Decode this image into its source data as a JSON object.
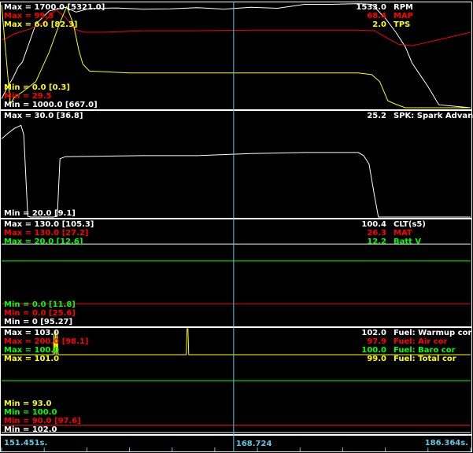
{
  "chart_data": [
    {
      "type": "line",
      "panel": "rpm-map-tps",
      "left_labels_top": [
        {
          "text": "Max = 1700.0 [5321.0]",
          "color": "#ffffff"
        },
        {
          "text": "Max = 99.5",
          "color": "#ff0000"
        },
        {
          "text": "Max = 6.0 [82.3]",
          "color": "#ffff00"
        }
      ],
      "left_labels_bottom": [
        {
          "text": "Min = 0.0 [0.3]",
          "color": "#ffff00"
        },
        {
          "text": "Min = 29.5",
          "color": "#ff0000"
        },
        {
          "text": "Min = 1000.0 [667.0]",
          "color": "#ffffff"
        }
      ],
      "right_labels": [
        {
          "value": "1533.0",
          "name": "RPM",
          "color": "#ffffff"
        },
        {
          "value": "68.4",
          "name": "MAP",
          "color": "#ff0000"
        },
        {
          "value": "2.0",
          "name": "TPS",
          "color": "#ffff00"
        }
      ],
      "series": [
        {
          "color": "#ffffff",
          "ylim": [
            1000,
            1700
          ],
          "x": [
            151.45,
            151.9,
            152.3,
            152.7,
            153.0,
            154.0,
            155.0,
            156.2,
            157.0,
            158.0,
            160.0,
            162.0,
            164.0,
            166.0,
            168.0,
            170.0,
            172.0,
            174.0,
            176.0,
            178.0,
            179.0,
            180.0,
            180.8,
            181.5,
            182.0,
            182.6,
            183.2,
            184.0,
            186.36
          ],
          "y": [
            1060,
            1140,
            1200,
            1275,
            1305,
            1560,
            1648,
            1672,
            1640,
            1665,
            1668,
            1660,
            1662,
            1670,
            1660,
            1672,
            1666,
            1692,
            1692,
            1697,
            1692,
            1600,
            1505,
            1408,
            1300,
            1220,
            1140,
            1020,
            1000
          ]
        },
        {
          "color": "#ff0000",
          "ylim": [
            29.5,
            99.5
          ],
          "x": [
            151.45,
            151.8,
            152.4,
            153.5,
            154.5,
            155.5,
            156.2,
            156.9,
            157.6,
            159.0,
            162.0,
            166.0,
            170.0,
            174.0,
            178.0,
            179.2,
            180.0,
            181.0,
            182.0,
            183.0,
            184.0,
            186.36
          ],
          "y": [
            75,
            76,
            79,
            82,
            86,
            95,
            90,
            82,
            80,
            80,
            81,
            81,
            81.5,
            81.5,
            81.5,
            81,
            77,
            72,
            71,
            73,
            75,
            80
          ]
        },
        {
          "color": "#ffff00",
          "ylim": [
            0,
            6
          ],
          "x": [
            151.45,
            152.1,
            152.4,
            153.0,
            154.0,
            155.0,
            155.8,
            156.3,
            156.8,
            157.2,
            157.5,
            158.0,
            161.0,
            164.0,
            168.0,
            172.0,
            175.0,
            178.0,
            179.0,
            179.6,
            180.2,
            180.8,
            181.5,
            184.0,
            186.36
          ],
          "y": [
            5.9,
            0.2,
            0.6,
            0.9,
            1.5,
            3.2,
            4.9,
            5.8,
            4.8,
            3.3,
            2.5,
            2.1,
            2.0,
            2.0,
            2.0,
            2.0,
            2.0,
            2.0,
            1.9,
            1.5,
            0.4,
            0.2,
            0.0,
            0.0,
            0.0
          ]
        }
      ]
    },
    {
      "type": "line",
      "panel": "spark-advance",
      "left_labels_top": [
        {
          "text": "Max = 30.0 [36.8]",
          "color": "#ffffff"
        }
      ],
      "left_labels_bottom": [
        {
          "text": "Min = 20.0 [9.1]",
          "color": "#ffffff"
        }
      ],
      "right_labels": [
        {
          "value": "25.2",
          "name": "SPK: Spark Advance",
          "color": "#ffffff"
        }
      ],
      "series": [
        {
          "color": "#ffffff",
          "ylim": [
            20,
            30
          ],
          "x": [
            151.45,
            151.9,
            152.4,
            152.9,
            153.1,
            153.4,
            153.6,
            155.3,
            155.6,
            155.8,
            156.2,
            162.0,
            166.0,
            170.0,
            174.0,
            178.0,
            178.4,
            178.8,
            179.2,
            179.5,
            186.36
          ],
          "y": [
            27.4,
            27.9,
            28.4,
            28.7,
            27.8,
            20.0,
            19.5,
            19.5,
            20.0,
            25.5,
            25.7,
            25.8,
            25.8,
            26.0,
            26.1,
            26.1,
            25.8,
            25.0,
            22.0,
            19.5,
            19.5
          ]
        }
      ]
    },
    {
      "type": "line",
      "panel": "clt-mat-batt",
      "left_labels_top": [
        {
          "text": "Max = 130.0 [105.3]",
          "color": "#ffffff"
        },
        {
          "text": "Max = 130.0 [27.2]",
          "color": "#ff0000"
        },
        {
          "text": "Max = 20.0 [12.6]",
          "color": "#00ff00"
        }
      ],
      "left_labels_bottom": [
        {
          "text": "Min = 0.0 [11.8]",
          "color": "#00ff00"
        },
        {
          "text": "Min = 0.0 [25.6]",
          "color": "#ff0000"
        },
        {
          "text": "Min = 0 [95.27]",
          "color": "#ffffff"
        }
      ],
      "right_labels": [
        {
          "value": "100.4",
          "name": "CLT(s5)",
          "color": "#ffffff"
        },
        {
          "value": "26.3",
          "name": "MAT",
          "color": "#ff0000"
        },
        {
          "value": "12.2",
          "name": "Batt V",
          "color": "#00ff00"
        }
      ],
      "series": [
        {
          "color": "#ffffff",
          "ylim": [
            0,
            130
          ],
          "x": [
            151.45,
            186.36
          ],
          "y": [
            100.4,
            100.4
          ]
        },
        {
          "color": "#ff0000",
          "ylim": [
            0,
            130
          ],
          "x": [
            151.45,
            186.36
          ],
          "y": [
            26.3,
            26.3
          ]
        },
        {
          "color": "#00ff00",
          "ylim": [
            0,
            20
          ],
          "x": [
            151.45,
            186.36
          ],
          "y": [
            12.2,
            12.2
          ]
        }
      ]
    },
    {
      "type": "line",
      "panel": "fuel-corrections",
      "left_labels_top": [
        {
          "text": "Max = 103.0",
          "color": "#ffffff"
        },
        {
          "text": "Max = 200.0 [98.1]",
          "color": "#ff0000"
        },
        {
          "text": "Max = 100.0",
          "color": "#00ff00"
        },
        {
          "text": "Max = 101.0",
          "color": "#ffff00"
        }
      ],
      "left_labels_bottom": [
        {
          "text": "Min = 93.0",
          "color": "#ffff00"
        },
        {
          "text": "Min = 100.0",
          "color": "#00ff00"
        },
        {
          "text": "Min = 90.0 [97.6]",
          "color": "#ff0000"
        },
        {
          "text": "Min = 102.0",
          "color": "#ffffff"
        }
      ],
      "right_labels": [
        {
          "value": "102.0",
          "name": "Fuel: Warmup cor",
          "color": "#ffffff"
        },
        {
          "value": "97.9",
          "name": "Fuel: Air cor",
          "color": "#ff0000"
        },
        {
          "value": "100.0",
          "name": "Fuel: Baro cor",
          "color": "#00ff00"
        },
        {
          "value": "99.0",
          "name": "Fuel: Total cor",
          "color": "#ffff00"
        }
      ],
      "series": [
        {
          "color": "#ffffff",
          "ylim": [
            102,
            103
          ],
          "x": [
            151.45,
            186.36
          ],
          "y": [
            102,
            102
          ]
        },
        {
          "color": "#ff0000",
          "ylim": [
            90,
            200
          ],
          "x": [
            151.45,
            186.36
          ],
          "y": [
            97.9,
            97.9
          ]
        },
        {
          "color": "#00ff00",
          "ylim": [
            100,
            100
          ],
          "x": [
            151.45,
            186.36
          ],
          "y": [
            100,
            100
          ]
        },
        {
          "color": "#ffff00",
          "ylim": [
            93,
            101
          ],
          "x": [
            151.45,
            155.3,
            155.36,
            155.42,
            155.48,
            155.54,
            155.6,
            155.66,
            165.2,
            165.26,
            165.32,
            165.38,
            186.36
          ],
          "y": [
            99,
            99,
            100.6,
            99,
            100.8,
            99,
            100.5,
            99,
            99,
            101,
            101,
            99,
            99
          ]
        }
      ]
    }
  ],
  "time_axis": {
    "start_label": "151.451s.",
    "cursor_label": "168.724",
    "end_label": "186.364s.",
    "cursor_value": 168.724,
    "range": [
      151.451,
      186.364
    ]
  },
  "colors": {
    "background": "#000000",
    "frame": "#ffffff",
    "cursor": "#5ec8e6",
    "axis_text": "#5ec8e6"
  }
}
